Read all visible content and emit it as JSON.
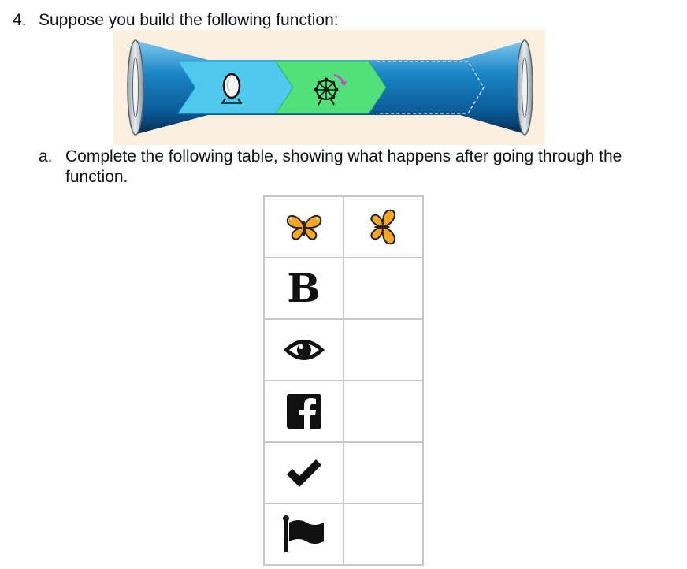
{
  "question": {
    "number": "4.",
    "prompt": "Suppose you build the following function:"
  },
  "function_machine": {
    "stages": [
      {
        "name": "mirror",
        "icon": "mirror-icon",
        "color": "#4fc8ee"
      },
      {
        "name": "rotate",
        "icon": "ferris-wheel-icon",
        "color": "#52e07a"
      }
    ],
    "tube_color": "#0a66a8"
  },
  "part_a": {
    "letter": "a.",
    "instruction": "Complete the following table, showing what happens after going through the function."
  },
  "table": {
    "rows": [
      {
        "input_icon": "butterfly-icon",
        "output_icon": "butterfly-rotated-icon"
      },
      {
        "input_text": "B",
        "output_text": ""
      },
      {
        "input_icon": "eye-icon",
        "output_text": ""
      },
      {
        "input_icon": "facebook-icon",
        "output_text": ""
      },
      {
        "input_icon": "checkmark-icon",
        "output_text": ""
      },
      {
        "input_icon": "flag-icon",
        "output_text": ""
      }
    ]
  }
}
